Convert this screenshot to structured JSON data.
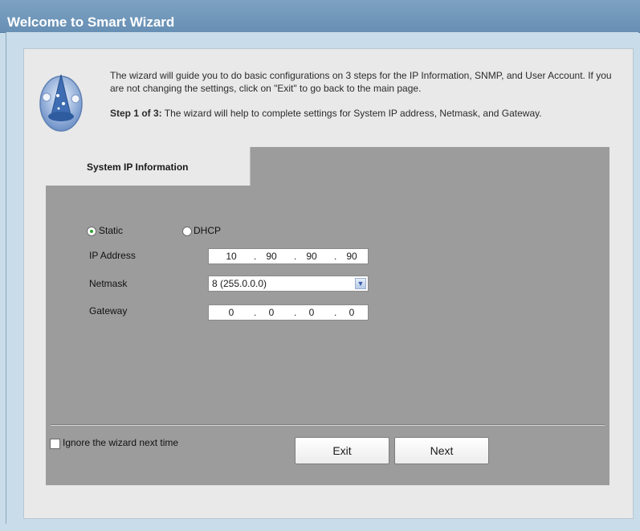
{
  "header": {
    "title": "Welcome to Smart Wizard"
  },
  "intro": {
    "text": "The wizard will guide you to do basic configurations on 3 steps for the IP Information, SNMP, and User Account. If you are not changing the settings, click on \"Exit\" to go back to the main page.",
    "step_label": "Step 1 of 3:",
    "step_text": " The wizard will help to complete settings for System IP address, Netmask, and Gateway.",
    "icon": "wizard-icon"
  },
  "tab": {
    "label": "System IP Information"
  },
  "mode": {
    "static_label": "Static",
    "dhcp_label": "DHCP",
    "selected": "Static"
  },
  "fields": {
    "ip_label": "IP Address",
    "ip": [
      "10",
      "90",
      "90",
      "90"
    ],
    "netmask_label": "Netmask",
    "netmask_value": "8 (255.0.0.0)",
    "gateway_label": "Gateway",
    "gateway": [
      "0",
      "0",
      "0",
      "0"
    ]
  },
  "footer": {
    "ignore_label": "Ignore the wizard next time",
    "exit_label": "Exit",
    "next_label": "Next"
  },
  "colors": {
    "titlebar": "#6f95b8",
    "content": "#9c9c9c",
    "radio_selected": "#2aa52a"
  }
}
